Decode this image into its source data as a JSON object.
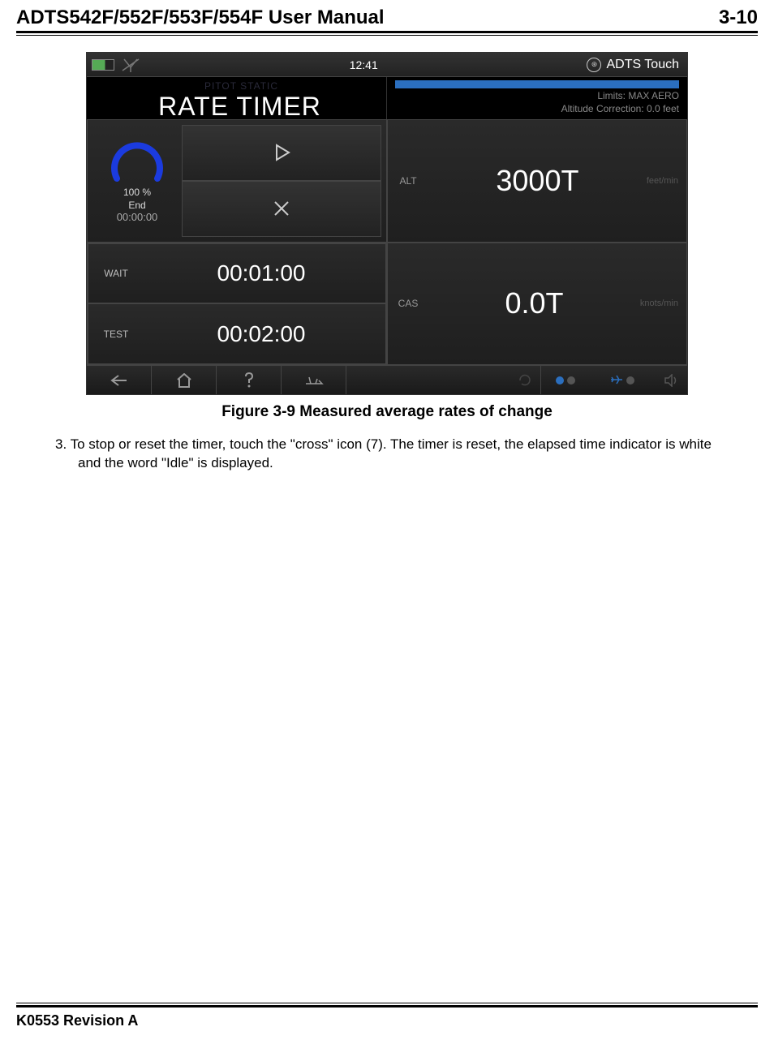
{
  "header": {
    "doc_title": "ADTS542F/552F/553F/554F User Manual",
    "page_number": "3-10"
  },
  "screen": {
    "status": {
      "time": "12:41",
      "brand": "ADTS Touch"
    },
    "subheader": {
      "pitot_label": "PITOT STATIC",
      "title": "RATE TIMER",
      "limits_line1": "Limits: MAX AERO",
      "limits_line2": "Altitude Correction: 0.0 feet"
    },
    "timer": {
      "percent": "100 %",
      "state": "End",
      "elapsed": "00:00:00"
    },
    "alt": {
      "label": "ALT",
      "value": "3000T",
      "unit": "feet/min"
    },
    "cas": {
      "label": "CAS",
      "value": "0.0T",
      "unit": "knots/min"
    },
    "wait": {
      "label": "WAIT",
      "value": "00:01:00"
    },
    "test": {
      "label": "TEST",
      "value": "00:02:00"
    }
  },
  "figure_caption": "Figure 3-9 Measured average rates of change",
  "body_paragraph": "3. To stop or reset the timer, touch the \"cross\" icon (7). The timer is reset, the elapsed time indicator is white and the word \"Idle\" is displayed.",
  "footer": {
    "revision": "K0553 Revision A"
  }
}
